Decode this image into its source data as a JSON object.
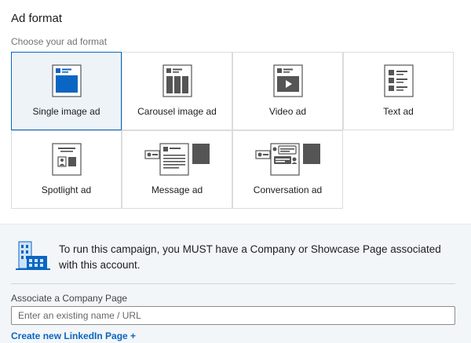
{
  "ad_format": {
    "title": "Ad format",
    "subtitle": "Choose your ad format",
    "selected": "single-image",
    "options": [
      {
        "id": "single-image",
        "label": "Single image ad",
        "icon": "single-image-ad-icon"
      },
      {
        "id": "carousel-image",
        "label": "Carousel image ad",
        "icon": "carousel-image-ad-icon"
      },
      {
        "id": "video",
        "label": "Video ad",
        "icon": "video-ad-icon"
      },
      {
        "id": "text",
        "label": "Text ad",
        "icon": "text-ad-icon"
      },
      {
        "id": "spotlight",
        "label": "Spotlight ad",
        "icon": "spotlight-ad-icon"
      },
      {
        "id": "message",
        "label": "Message ad",
        "icon": "message-ad-icon"
      },
      {
        "id": "conversation",
        "label": "Conversation ad",
        "icon": "conversation-ad-icon"
      }
    ]
  },
  "company_page": {
    "notice": "To run this campaign, you MUST have a Company or Showcase Page associated with this account.",
    "field_label": "Associate a Company Page",
    "field_placeholder": "Enter an existing name / URL",
    "field_value": "",
    "create_link": "Create new LinkedIn Page +"
  },
  "colors": {
    "accent": "#0a66c2",
    "selected_bg": "#eef3f8",
    "panel_bg": "#f3f6f8",
    "icon_dark": "#4d4d4d"
  }
}
